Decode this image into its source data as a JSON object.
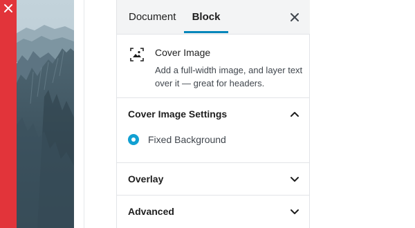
{
  "tabs": {
    "document_label": "Document",
    "block_label": "Block",
    "active": "Block"
  },
  "block": {
    "icon": "cover-image-icon",
    "title": "Cover Image",
    "description": "Add a full-width image, and layer text over it — great for headers."
  },
  "panels": {
    "settings": {
      "title": "Cover Image Settings",
      "expanded": true,
      "option_label": "Fixed Background",
      "option_checked": true
    },
    "overlay": {
      "title": "Overlay",
      "expanded": false
    },
    "advanced": {
      "title": "Advanced",
      "expanded": false
    }
  },
  "colors": {
    "accent": "#0085ba",
    "radio": "#11a0d2",
    "close_strip": "#e2343a"
  }
}
